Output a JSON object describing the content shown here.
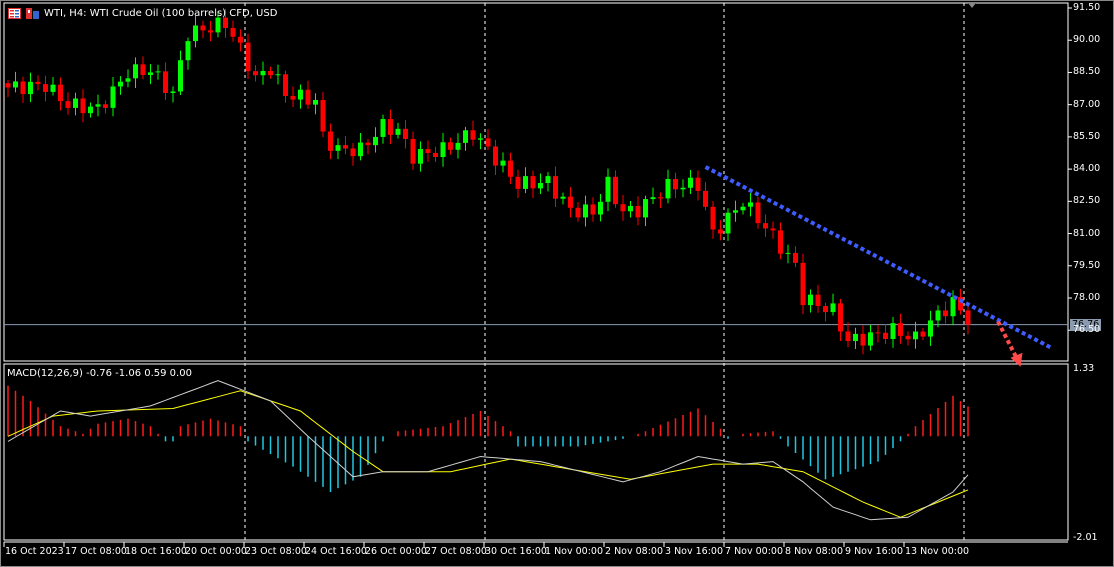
{
  "header": {
    "title": "WTI, H4:  WTI Crude Oil (100 barrels) CFD, USD"
  },
  "current_price": "76.76",
  "macd_label": "MACD(12,26,9) -0.76 -1.06 0.59 0.00",
  "colors": {
    "bull": "#00ff00",
    "bear": "#ff0000",
    "trendline": "#3f5cff",
    "arrow": "#ff4a4a",
    "hist_pos": "#ff1a1a",
    "hist_neg": "#1ec8e0",
    "macd_main": "#d0d0d0",
    "macd_signal": "#ffff00"
  },
  "chart_data": [
    {
      "type": "candlestick",
      "title": "WTI, H4",
      "bars": 129,
      "ylim": [
        75.5,
        91.6
      ],
      "yticks": [
        "91.50",
        "90.00",
        "88.50",
        "87.00",
        "85.50",
        "84.00",
        "82.50",
        "81.00",
        "79.50",
        "78.00",
        "76.50"
      ],
      "xticks": [
        "16 Oct 2023",
        "17 Oct 08:00",
        "18 Oct 16:00",
        "20 Oct 00:00",
        "23 Oct 08:00",
        "24 Oct 16:00",
        "26 Oct 00:00",
        "27 Oct 08:00",
        "30 Oct 16:00",
        "1 Nov 00:00",
        "2 Nov 08:00",
        "3 Nov 16:00",
        "7 Nov 00:00",
        "8 Nov 08:00",
        "9 Nov 16:00",
        "13 Nov 00:00"
      ],
      "close_keypoints": [
        [
          0,
          87.8
        ],
        [
          5,
          87.9
        ],
        [
          8,
          87.0
        ],
        [
          12,
          86.8
        ],
        [
          14,
          87.6
        ],
        [
          16,
          88.5
        ],
        [
          19,
          88.6
        ],
        [
          22,
          87.5
        ],
        [
          24,
          90.3
        ],
        [
          26,
          90.5
        ],
        [
          29,
          90.8
        ],
        [
          31,
          89.6
        ],
        [
          33,
          88.2
        ],
        [
          35,
          88.7
        ],
        [
          37,
          87.5
        ],
        [
          41,
          87.2
        ],
        [
          42,
          85.5
        ],
        [
          44,
          84.9
        ],
        [
          47,
          84.9
        ],
        [
          50,
          86.0
        ],
        [
          52,
          85.8
        ],
        [
          54,
          84.6
        ],
        [
          58,
          84.9
        ],
        [
          62,
          85.7
        ],
        [
          64,
          84.9
        ],
        [
          68,
          83.3
        ],
        [
          72,
          83.4
        ],
        [
          75,
          82.1
        ],
        [
          78,
          82.0
        ],
        [
          80,
          83.3
        ],
        [
          82,
          82.0
        ],
        [
          84,
          82.1
        ],
        [
          88,
          83.2
        ],
        [
          92,
          83.3
        ],
        [
          94,
          81.0
        ],
        [
          96,
          81.7
        ],
        [
          98,
          82.5
        ],
        [
          101,
          81.3
        ],
        [
          105,
          79.5
        ],
        [
          106,
          78.0
        ],
        [
          110,
          77.4
        ],
        [
          112,
          76.0
        ],
        [
          115,
          76.2
        ],
        [
          118,
          76.5
        ],
        [
          121,
          76.1
        ],
        [
          123,
          76.9
        ],
        [
          126,
          77.8
        ],
        [
          127,
          77.4
        ],
        [
          128,
          76.76
        ]
      ],
      "trendline": {
        "from": [
          93,
          84.1
        ],
        "to": [
          139,
          75.7
        ]
      },
      "projection_arrow": {
        "from": [
          132,
          76.9
        ],
        "to": [
          135,
          74.8
        ]
      },
      "current_price": 76.76
    },
    {
      "type": "macd",
      "params": "12,26,9",
      "ylim": [
        -2.01,
        1.33
      ],
      "yticks": [
        "1.33",
        "-2.01"
      ],
      "histogram_keypoints": [
        [
          0,
          1.0
        ],
        [
          3,
          0.7
        ],
        [
          7,
          0.2
        ],
        [
          10,
          0.05
        ],
        [
          12,
          0.25
        ],
        [
          16,
          0.35
        ],
        [
          19,
          0.2
        ],
        [
          21,
          -0.1
        ],
        [
          22,
          -0.1
        ],
        [
          23,
          0.2
        ],
        [
          27,
          0.35
        ],
        [
          31,
          0.2
        ],
        [
          32,
          -0.1
        ],
        [
          38,
          -0.6
        ],
        [
          43,
          -1.1
        ],
        [
          47,
          -0.8
        ],
        [
          50,
          -0.1
        ],
        [
          52,
          0.1
        ],
        [
          58,
          0.2
        ],
        [
          63,
          0.5
        ],
        [
          67,
          0.1
        ],
        [
          68,
          -0.2
        ],
        [
          76,
          -0.2
        ],
        [
          82,
          -0.05
        ],
        [
          85,
          0.1
        ],
        [
          92,
          0.55
        ],
        [
          95,
          0.15
        ],
        [
          96,
          -0.05
        ],
        [
          98,
          0.05
        ],
        [
          102,
          0.1
        ],
        [
          104,
          -0.2
        ],
        [
          109,
          -0.85
        ],
        [
          116,
          -0.5
        ],
        [
          119,
          -0.1
        ],
        [
          121,
          0.2
        ],
        [
          126,
          0.8
        ],
        [
          128,
          0.59
        ]
      ],
      "main_keypoints": [
        [
          0,
          -0.1
        ],
        [
          7,
          0.5
        ],
        [
          11,
          0.4
        ],
        [
          19,
          0.6
        ],
        [
          28,
          1.1
        ],
        [
          35,
          0.7
        ],
        [
          40,
          0
        ],
        [
          46,
          -0.8
        ],
        [
          50,
          -0.7
        ],
        [
          56,
          -0.7
        ],
        [
          63,
          -0.4
        ],
        [
          71,
          -0.5
        ],
        [
          82,
          -0.9
        ],
        [
          87,
          -0.7
        ],
        [
          92,
          -0.4
        ],
        [
          98,
          -0.55
        ],
        [
          102,
          -0.5
        ],
        [
          106,
          -0.9
        ],
        [
          110,
          -1.4
        ],
        [
          115,
          -1.65
        ],
        [
          120,
          -1.6
        ],
        [
          126,
          -1.1
        ],
        [
          128,
          -0.76
        ]
      ],
      "signal_keypoints": [
        [
          0,
          0
        ],
        [
          6,
          0.4
        ],
        [
          12,
          0.5
        ],
        [
          22,
          0.55
        ],
        [
          31,
          0.9
        ],
        [
          39,
          0.5
        ],
        [
          46,
          -0.3
        ],
        [
          50,
          -0.7
        ],
        [
          59,
          -0.7
        ],
        [
          67,
          -0.45
        ],
        [
          83,
          -0.85
        ],
        [
          94,
          -0.55
        ],
        [
          100,
          -0.55
        ],
        [
          106,
          -0.7
        ],
        [
          114,
          -1.3
        ],
        [
          119,
          -1.6
        ],
        [
          128,
          -1.06
        ]
      ]
    }
  ]
}
